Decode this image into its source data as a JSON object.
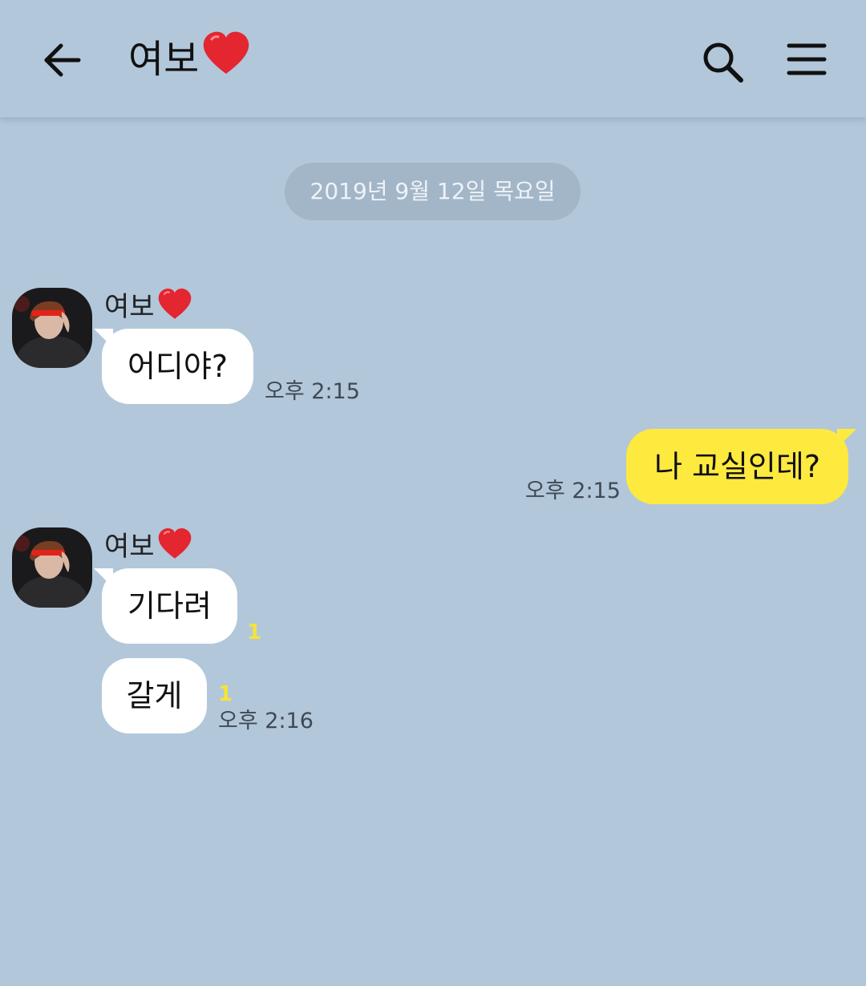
{
  "header": {
    "title": "여보",
    "back_icon": "arrow-left-icon",
    "search_icon": "search-icon",
    "menu_icon": "hamburger-menu-icon",
    "title_emoji": "heart-icon"
  },
  "date_divider": "2019년 9월 12일 목요일",
  "contact": {
    "name": "여보"
  },
  "messages": [
    {
      "direction": "in",
      "text": "어디야?",
      "time": "오후 2:15",
      "unread": ""
    },
    {
      "direction": "out",
      "text": "나 교실인데?",
      "time": "오후 2:15",
      "unread": ""
    },
    {
      "direction": "in",
      "text": "기다려",
      "time": "",
      "unread": "1"
    },
    {
      "direction": "in",
      "text": "갈게",
      "time": "오후 2:16",
      "unread": "1"
    }
  ],
  "colors": {
    "background": "#b2c7da",
    "incoming_bubble": "#ffffff",
    "outgoing_bubble": "#fee93f",
    "date_pill": "#a3b6c8",
    "unread_count": "#f5e33b",
    "heart": "#e3262f"
  }
}
